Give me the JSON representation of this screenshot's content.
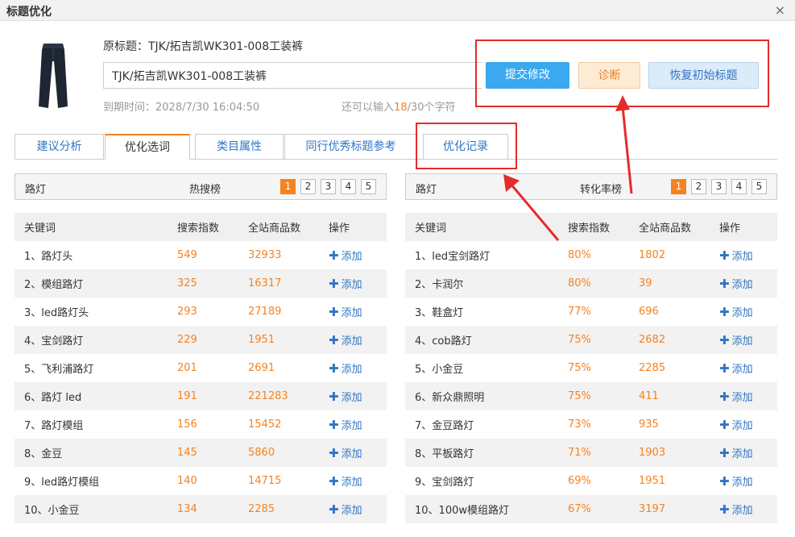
{
  "dialog": {
    "title": "标题优化",
    "close_label": "×"
  },
  "product": {
    "original_title": "原标题：TJK/拓吉凯WK301-008工装裤",
    "title_value": "TJK/拓吉凯WK301-008工装裤",
    "expire": "到期时间：2028/7/30 16:04:50",
    "remain_prefix": "还可以输入",
    "remain_count": "18",
    "remain_suffix": "/30个字符"
  },
  "buttons": {
    "submit": "提交修改",
    "diagnose": "诊断",
    "restore": "恢复初始标题"
  },
  "tabs": [
    "建议分析",
    "优化选词",
    "类目属性",
    "同行优秀标题参考",
    "优化记录"
  ],
  "left_panel": {
    "keyword": "路灯",
    "rank_label": "热搜榜",
    "pages": [
      "1",
      "2",
      "3",
      "4",
      "5"
    ],
    "columns": [
      "关键词",
      "搜索指数",
      "全站商品数",
      "操作"
    ],
    "add_label": "添加",
    "rows": [
      {
        "kw": "1、路灯头",
        "idx": "549",
        "count": "32933"
      },
      {
        "kw": "2、模组路灯",
        "idx": "325",
        "count": "16317"
      },
      {
        "kw": "3、led路灯头",
        "idx": "293",
        "count": "27189"
      },
      {
        "kw": "4、宝剑路灯",
        "idx": "229",
        "count": "1951"
      },
      {
        "kw": "5、飞利浦路灯",
        "idx": "201",
        "count": "2691"
      },
      {
        "kw": "6、路灯 led",
        "idx": "191",
        "count": "221283"
      },
      {
        "kw": "7、路灯模组",
        "idx": "156",
        "count": "15452"
      },
      {
        "kw": "8、金豆",
        "idx": "145",
        "count": "5860"
      },
      {
        "kw": "9、led路灯模组",
        "idx": "140",
        "count": "14715"
      },
      {
        "kw": "10、小金豆",
        "idx": "134",
        "count": "2285"
      }
    ]
  },
  "right_panel": {
    "keyword": "路灯",
    "rank_label": "转化率榜",
    "pages": [
      "1",
      "2",
      "3",
      "4",
      "5"
    ],
    "columns": [
      "关键词",
      "搜索指数",
      "全站商品数",
      "操作"
    ],
    "add_label": "添加",
    "rows": [
      {
        "kw": "1、led宝剑路灯",
        "idx": "80%",
        "count": "1802"
      },
      {
        "kw": "2、卡润尔",
        "idx": "80%",
        "count": "39"
      },
      {
        "kw": "3、鞋盒灯",
        "idx": "77%",
        "count": "696"
      },
      {
        "kw": "4、cob路灯",
        "idx": "75%",
        "count": "2682"
      },
      {
        "kw": "5、小金豆",
        "idx": "75%",
        "count": "2285"
      },
      {
        "kw": "6、新众鼎照明",
        "idx": "75%",
        "count": "411"
      },
      {
        "kw": "7、金豆路灯",
        "idx": "73%",
        "count": "935"
      },
      {
        "kw": "8、平板路灯",
        "idx": "71%",
        "count": "1903"
      },
      {
        "kw": "9、宝剑路灯",
        "idx": "69%",
        "count": "1951"
      },
      {
        "kw": "10、100w模组路灯",
        "idx": "67%",
        "count": "3197"
      }
    ]
  },
  "colors": {
    "accent_orange": "#f58220",
    "link_blue": "#2f75c4",
    "annotation_red": "#e42b2b"
  }
}
